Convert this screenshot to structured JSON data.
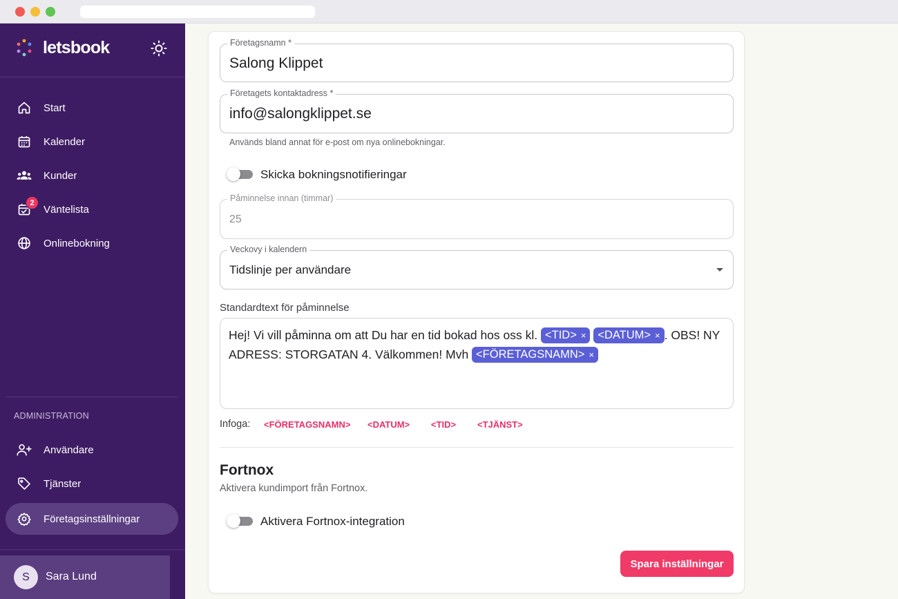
{
  "app": {
    "brand": "letsbook"
  },
  "sidebar": {
    "items": [
      {
        "label": "Start",
        "icon": "home-icon"
      },
      {
        "label": "Kalender",
        "icon": "calendar-icon"
      },
      {
        "label": "Kunder",
        "icon": "users-icon"
      },
      {
        "label": "Väntelista",
        "icon": "calendar-check-icon",
        "badge": "2"
      },
      {
        "label": "Onlinebokning",
        "icon": "globe-icon"
      }
    ],
    "admin_section_label": "ADMINISTRATION",
    "admin_items": [
      {
        "label": "Användare",
        "icon": "user-plus-icon"
      },
      {
        "label": "Tjänster",
        "icon": "tag-icon"
      },
      {
        "label": "Företagsinställningar",
        "icon": "gear-icon",
        "active": true
      }
    ],
    "user": {
      "initial": "S",
      "name": "Sara Lund"
    }
  },
  "form": {
    "company_name": {
      "label": "Företagsnamn *",
      "value": "Salong Klippet"
    },
    "contact_address": {
      "label": "Företagets kontaktadress *",
      "value": "info@salongklippet.se",
      "helper": "Används bland annat för e-post om nya onlinebokningar."
    },
    "notifications_toggle": {
      "label": "Skicka bokningsnotifieringar",
      "checked": false
    },
    "reminder_hours": {
      "label": "Påminnelse innan (timmar)",
      "value": "25",
      "disabled": true
    },
    "week_view": {
      "label": "Veckovy i kalendern",
      "value": "Tidslinje per användare"
    },
    "reminder_text": {
      "label": "Standardtext för påminnelse",
      "part1": "Hej! Vi vill påminna om att Du har en tid bokad hos oss kl.",
      "chip_tid": "<TID>",
      "chip_datum": "<DATUM>",
      "part2": ". OBS! NY ADRESS: STORGATAN 4. Välkommen! Mvh",
      "chip_company": "<FÖRETAGSNAMN>",
      "chip_remove": "×"
    },
    "insert": {
      "label": "Infoga:",
      "tags": [
        "<FÖRETAGSNAMN>",
        "<DATUM>",
        "<TID>",
        "<TJÄNST>"
      ]
    }
  },
  "fortnox": {
    "title": "Fortnox",
    "description": "Aktivera kundimport från Fortnox.",
    "toggle_label": "Aktivera Fortnox-integration",
    "checked": false
  },
  "actions": {
    "save_label": "Spara inställningar"
  },
  "colors": {
    "sidebar_bg": "#3e1c63",
    "sidebar_active": "#5c3f82",
    "accent": "#f03a67",
    "chip": "#5b5fd6",
    "insert_tag": "#ea2f66",
    "badge": "#ea3764"
  }
}
